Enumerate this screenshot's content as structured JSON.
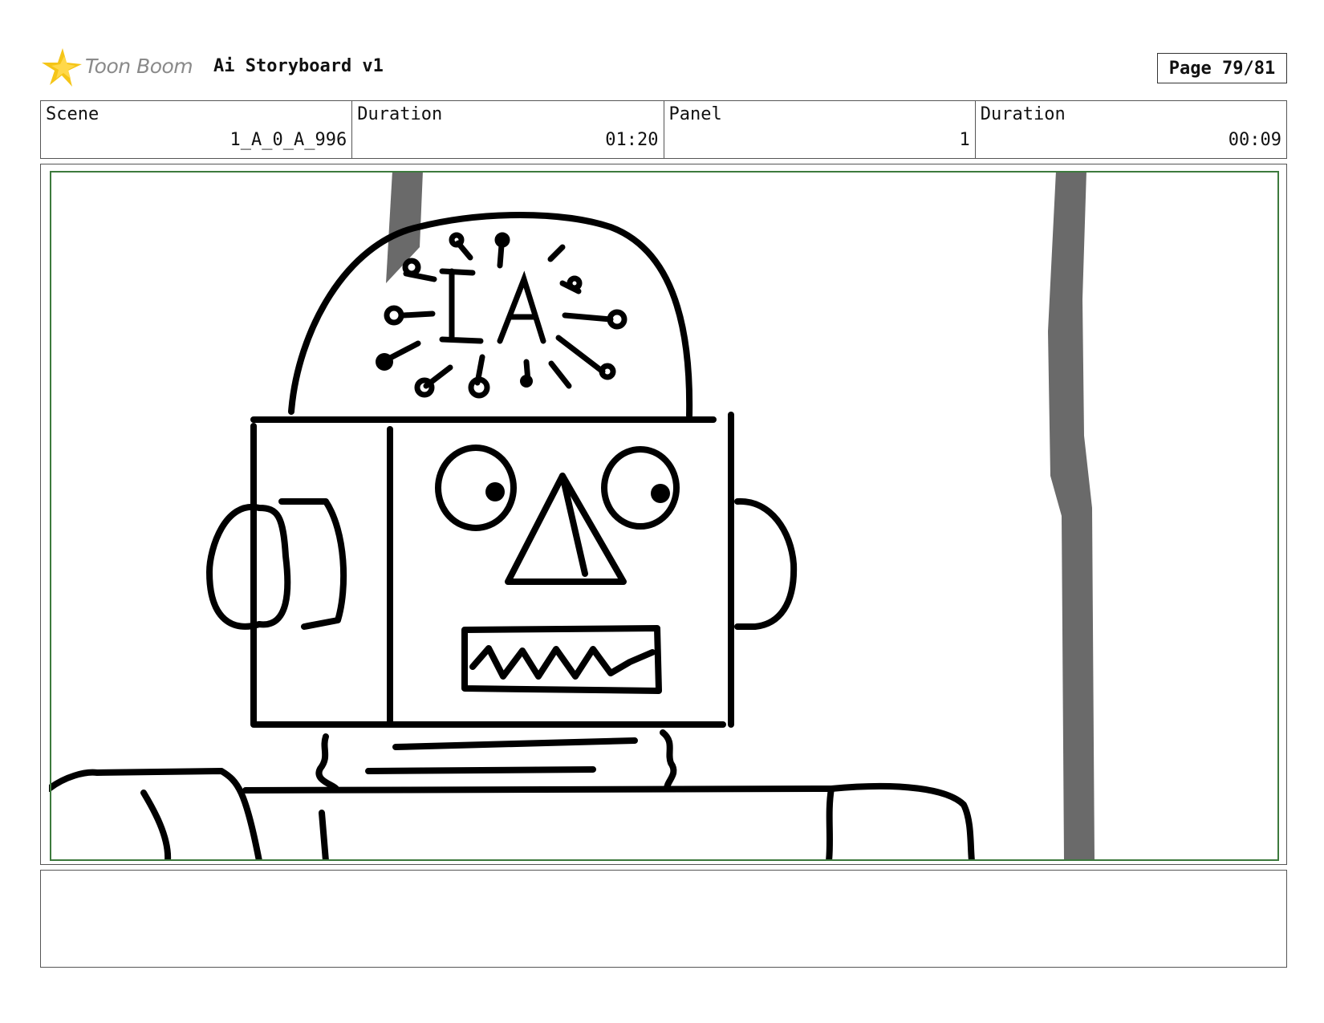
{
  "header": {
    "logo_text": "Toon Boom",
    "title": "Ai Storyboard v1",
    "page": "Page 79/81"
  },
  "info": {
    "scene_label": "Scene",
    "scene_value": "1_A_0_A_996",
    "scene_duration_label": "Duration",
    "scene_duration_value": "01:20",
    "panel_label": "Panel",
    "panel_value": "1",
    "panel_duration_label": "Duration",
    "panel_duration_value": "00:09"
  },
  "panel": {
    "head_lettering": "IA",
    "safe_frame_color": "#3d7a3d"
  },
  "notes": {
    "text": ""
  },
  "colors": {
    "logo_star": "#f5c518",
    "logo_text": "#8a8a8a",
    "ink": "#000000",
    "pole": "#6a6a6a"
  }
}
